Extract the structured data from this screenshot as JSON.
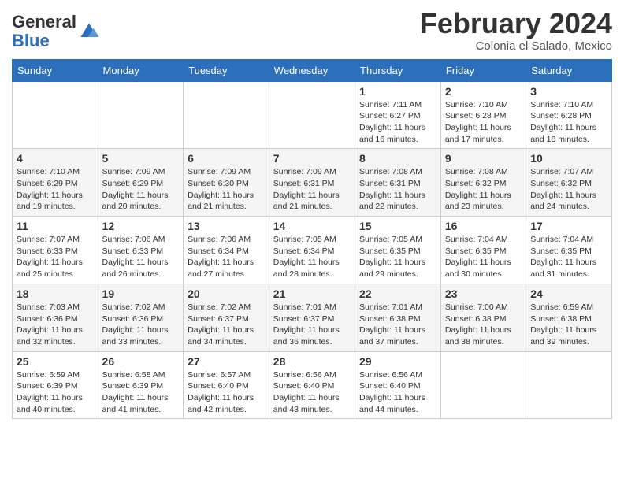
{
  "header": {
    "logo_general": "General",
    "logo_blue": "Blue",
    "month_title": "February 2024",
    "location": "Colonia el Salado, Mexico"
  },
  "weekdays": [
    "Sunday",
    "Monday",
    "Tuesday",
    "Wednesday",
    "Thursday",
    "Friday",
    "Saturday"
  ],
  "weeks": [
    [
      {
        "day": "",
        "info": ""
      },
      {
        "day": "",
        "info": ""
      },
      {
        "day": "",
        "info": ""
      },
      {
        "day": "",
        "info": ""
      },
      {
        "day": "1",
        "info": "Sunrise: 7:11 AM\nSunset: 6:27 PM\nDaylight: 11 hours and 16 minutes."
      },
      {
        "day": "2",
        "info": "Sunrise: 7:10 AM\nSunset: 6:28 PM\nDaylight: 11 hours and 17 minutes."
      },
      {
        "day": "3",
        "info": "Sunrise: 7:10 AM\nSunset: 6:28 PM\nDaylight: 11 hours and 18 minutes."
      }
    ],
    [
      {
        "day": "4",
        "info": "Sunrise: 7:10 AM\nSunset: 6:29 PM\nDaylight: 11 hours and 19 minutes."
      },
      {
        "day": "5",
        "info": "Sunrise: 7:09 AM\nSunset: 6:29 PM\nDaylight: 11 hours and 20 minutes."
      },
      {
        "day": "6",
        "info": "Sunrise: 7:09 AM\nSunset: 6:30 PM\nDaylight: 11 hours and 21 minutes."
      },
      {
        "day": "7",
        "info": "Sunrise: 7:09 AM\nSunset: 6:31 PM\nDaylight: 11 hours and 21 minutes."
      },
      {
        "day": "8",
        "info": "Sunrise: 7:08 AM\nSunset: 6:31 PM\nDaylight: 11 hours and 22 minutes."
      },
      {
        "day": "9",
        "info": "Sunrise: 7:08 AM\nSunset: 6:32 PM\nDaylight: 11 hours and 23 minutes."
      },
      {
        "day": "10",
        "info": "Sunrise: 7:07 AM\nSunset: 6:32 PM\nDaylight: 11 hours and 24 minutes."
      }
    ],
    [
      {
        "day": "11",
        "info": "Sunrise: 7:07 AM\nSunset: 6:33 PM\nDaylight: 11 hours and 25 minutes."
      },
      {
        "day": "12",
        "info": "Sunrise: 7:06 AM\nSunset: 6:33 PM\nDaylight: 11 hours and 26 minutes."
      },
      {
        "day": "13",
        "info": "Sunrise: 7:06 AM\nSunset: 6:34 PM\nDaylight: 11 hours and 27 minutes."
      },
      {
        "day": "14",
        "info": "Sunrise: 7:05 AM\nSunset: 6:34 PM\nDaylight: 11 hours and 28 minutes."
      },
      {
        "day": "15",
        "info": "Sunrise: 7:05 AM\nSunset: 6:35 PM\nDaylight: 11 hours and 29 minutes."
      },
      {
        "day": "16",
        "info": "Sunrise: 7:04 AM\nSunset: 6:35 PM\nDaylight: 11 hours and 30 minutes."
      },
      {
        "day": "17",
        "info": "Sunrise: 7:04 AM\nSunset: 6:35 PM\nDaylight: 11 hours and 31 minutes."
      }
    ],
    [
      {
        "day": "18",
        "info": "Sunrise: 7:03 AM\nSunset: 6:36 PM\nDaylight: 11 hours and 32 minutes."
      },
      {
        "day": "19",
        "info": "Sunrise: 7:02 AM\nSunset: 6:36 PM\nDaylight: 11 hours and 33 minutes."
      },
      {
        "day": "20",
        "info": "Sunrise: 7:02 AM\nSunset: 6:37 PM\nDaylight: 11 hours and 34 minutes."
      },
      {
        "day": "21",
        "info": "Sunrise: 7:01 AM\nSunset: 6:37 PM\nDaylight: 11 hours and 36 minutes."
      },
      {
        "day": "22",
        "info": "Sunrise: 7:01 AM\nSunset: 6:38 PM\nDaylight: 11 hours and 37 minutes."
      },
      {
        "day": "23",
        "info": "Sunrise: 7:00 AM\nSunset: 6:38 PM\nDaylight: 11 hours and 38 minutes."
      },
      {
        "day": "24",
        "info": "Sunrise: 6:59 AM\nSunset: 6:38 PM\nDaylight: 11 hours and 39 minutes."
      }
    ],
    [
      {
        "day": "25",
        "info": "Sunrise: 6:59 AM\nSunset: 6:39 PM\nDaylight: 11 hours and 40 minutes."
      },
      {
        "day": "26",
        "info": "Sunrise: 6:58 AM\nSunset: 6:39 PM\nDaylight: 11 hours and 41 minutes."
      },
      {
        "day": "27",
        "info": "Sunrise: 6:57 AM\nSunset: 6:40 PM\nDaylight: 11 hours and 42 minutes."
      },
      {
        "day": "28",
        "info": "Sunrise: 6:56 AM\nSunset: 6:40 PM\nDaylight: 11 hours and 43 minutes."
      },
      {
        "day": "29",
        "info": "Sunrise: 6:56 AM\nSunset: 6:40 PM\nDaylight: 11 hours and 44 minutes."
      },
      {
        "day": "",
        "info": ""
      },
      {
        "day": "",
        "info": ""
      }
    ]
  ]
}
